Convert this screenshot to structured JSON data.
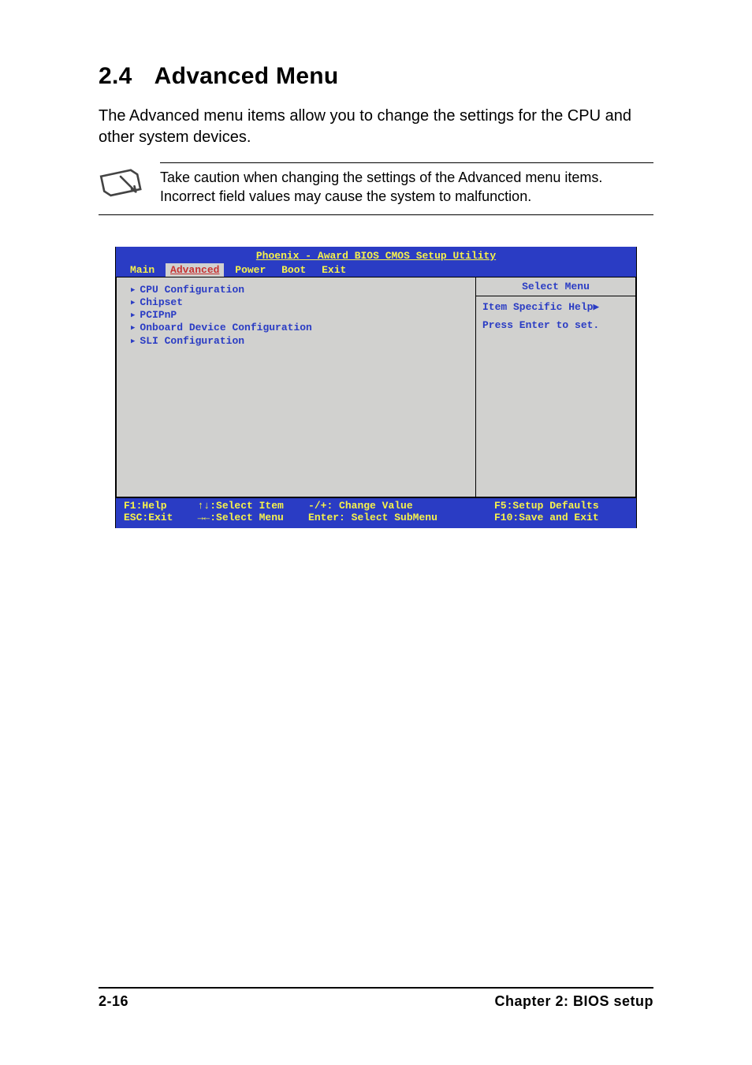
{
  "heading": {
    "number": "2.4",
    "title": "Advanced Menu"
  },
  "intro": "The Advanced menu items allow you to change the settings for the CPU and other system devices.",
  "note": "Take caution when changing the settings of the Advanced menu items. Incorrect field values may cause the system to malfunction.",
  "bios": {
    "title": "Phoenix - Award BIOS CMOS Setup Utility",
    "tabs": [
      "Main",
      "Advanced",
      "Power",
      "Boot",
      "Exit"
    ],
    "active_tab_index": 1,
    "menu_items": [
      "CPU Configuration",
      "Chipset",
      "PCIPnP",
      "Onboard Device Configuration",
      "SLI Configuration"
    ],
    "help": {
      "header": "Select Menu",
      "subhead": "Item Specific Help▶",
      "body": "Press Enter to set."
    },
    "footer": {
      "row1_left": "F1:Help     ↑↓:Select Item    -/+: Change Value",
      "row1_right": "F5:Setup Defaults",
      "row2_left": "ESC:Exit    →←:Select Menu    Enter: Select SubMenu",
      "row2_right": "F10:Save and Exit"
    }
  },
  "footer": {
    "page": "2-16",
    "chapter": "Chapter 2: BIOS setup"
  }
}
